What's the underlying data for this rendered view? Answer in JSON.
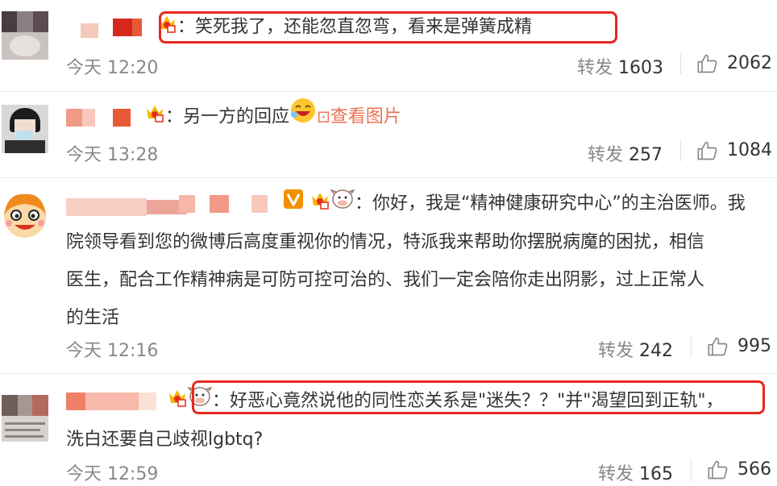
{
  "comments": [
    {
      "text": "：笑死我了，还能忽直忽弯，看来是弹簧成精",
      "time": "今天 12:20",
      "repost_label": "转发",
      "repost_count": "1603",
      "likes": "2062",
      "highlighted": true
    },
    {
      "text": "：另一方的回应",
      "link": "查看图片",
      "time": "今天 13:28",
      "repost_label": "转发",
      "repost_count": "257",
      "likes": "1084",
      "highlighted": false
    },
    {
      "text_line1": "：你好，我是“精神健康研究中心”的主治医师。我",
      "text_line2": "院领导看到您的微博后高度重视你的情况，特派我来帮助你摆脱病魔的困扰，相信",
      "text_line3": "医生，配合工作精神病是可防可控可治的、我们一定会陪你走出阴影，过上正常人",
      "text_line4": "的生活",
      "time": "今天 12:16",
      "repost_label": "转发",
      "repost_count": "242",
      "likes": "995",
      "highlighted": false
    },
    {
      "text_line1": "：好恶心竟然说他的同性恋关系是\"迷失？？\"并\"渴望回到正轨\"，",
      "text_line2": "洗白还要自己歧视lgbtq?",
      "time": "今天 12:59",
      "repost_label": "转发",
      "repost_count": "165",
      "likes": "566",
      "highlighted": true
    }
  ],
  "colors": {
    "highlight_border": "#e8281f",
    "link": "#eb7350",
    "meta_text": "#888888",
    "body_text": "#333333"
  },
  "icons": [
    "thumbs-up-icon",
    "crown-fan-badge-icon",
    "verified-v-icon",
    "image-icon",
    "cow-emoji-icon",
    "laughing-emoji-icon"
  ]
}
